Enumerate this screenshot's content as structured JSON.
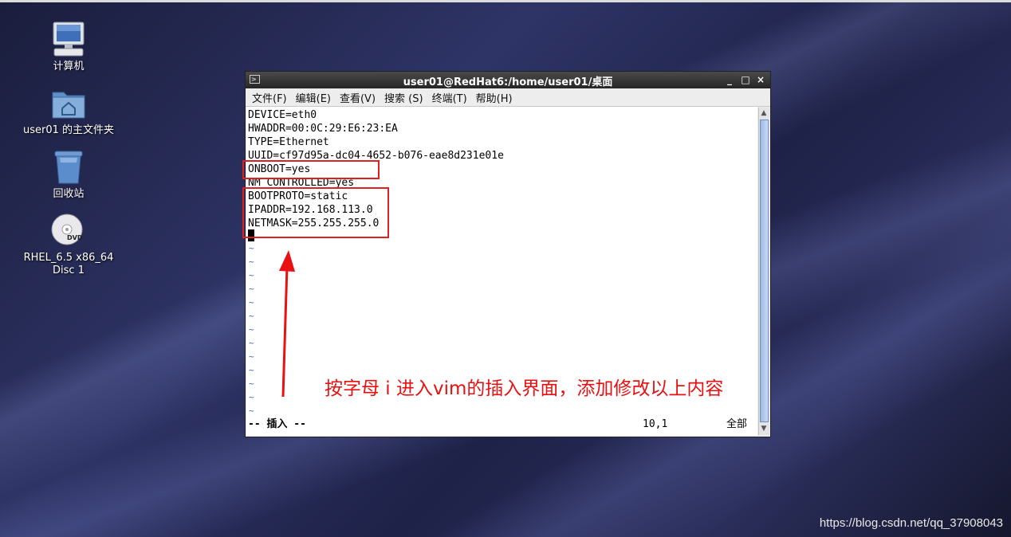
{
  "desktop": {
    "icons": [
      {
        "label": "计算机",
        "icon": "computer-icon"
      },
      {
        "label": "user01 的主文件夹",
        "icon": "home-folder-icon"
      },
      {
        "label": "回收站",
        "icon": "trash-icon"
      },
      {
        "label_line1": "RHEL_6.5 x86_64",
        "label_line2": "Disc 1",
        "icon": "dvd-icon",
        "badge": "DVD"
      }
    ]
  },
  "window": {
    "title": "user01@RedHat6:/home/user01/桌面",
    "minimize": "_",
    "maximize": "□",
    "close": "×",
    "menu": [
      "文件(F)",
      "编辑(E)",
      "查看(V)",
      "搜索 (S)",
      "终端(T)",
      "帮助(H)"
    ]
  },
  "terminal": {
    "lines": [
      "DEVICE=eth0",
      "HWADDR=00:0C:29:E6:23:EA",
      "TYPE=Ethernet",
      "UUID=cf97d95a-dc04-4652-b076-eae8d231e01e",
      "ONBOOT=yes",
      "NM_CONTROLLED=yes",
      "BOOTPROTO=static",
      "IPADDR=192.168.113.0",
      "NETMASK=255.255.255.0"
    ],
    "tilde": "~",
    "status_mode": "-- 插入 --",
    "status_pos": "10,1",
    "status_scroll": "全部"
  },
  "annotation": {
    "text": "按字母 i 进入vim的插入界面，添加修改以上内容",
    "color": "#e81010"
  },
  "watermark": "https://blog.csdn.net/qq_37908043"
}
